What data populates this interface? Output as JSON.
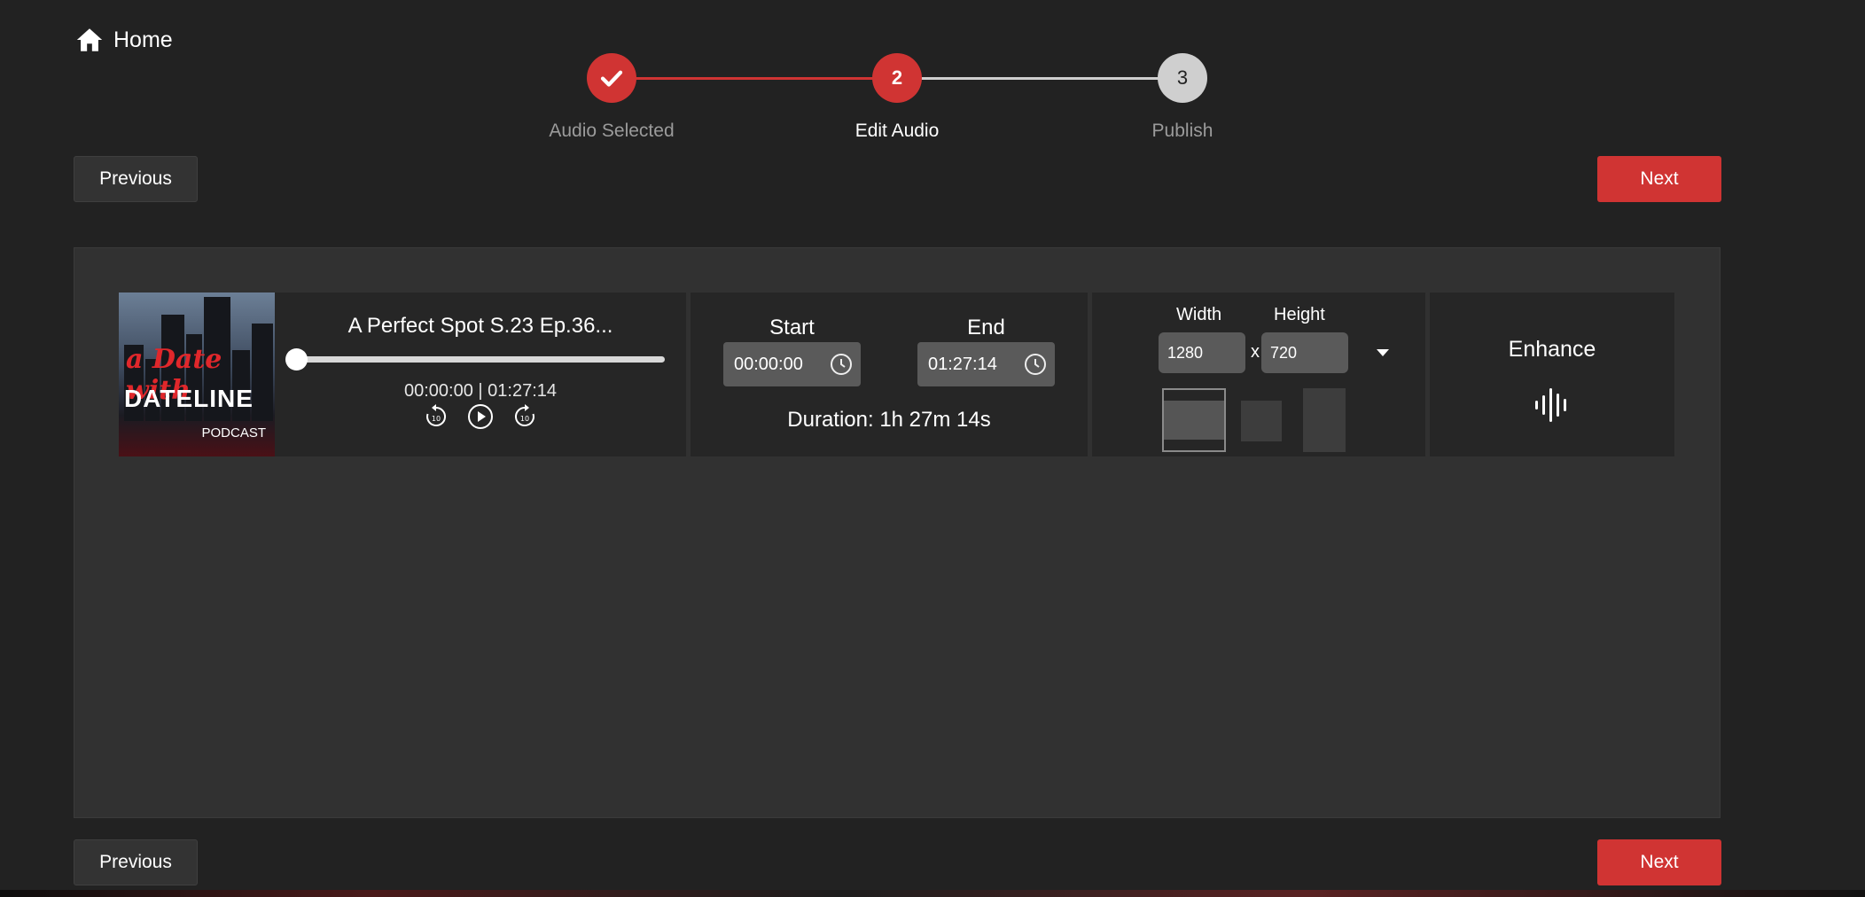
{
  "header": {
    "home_label": "Home"
  },
  "stepper": {
    "steps": [
      {
        "number": "1",
        "label": "Audio Selected",
        "state": "complete"
      },
      {
        "number": "2",
        "label": "Edit Audio",
        "state": "active"
      },
      {
        "number": "3",
        "label": "Publish",
        "state": "pending"
      }
    ]
  },
  "nav": {
    "previous_label": "Previous",
    "next_label": "Next"
  },
  "player": {
    "artwork": {
      "line1": "a Date with",
      "line2": "DATELINE",
      "line3": "PODCAST"
    },
    "track_title": "A Perfect Spot S.23 Ep.36...",
    "position": "00:00:00",
    "separator": "|",
    "total": "01:27:14",
    "progress_fraction": 0,
    "controls": [
      "rewind-10-icon",
      "play-icon",
      "forward-10-icon"
    ]
  },
  "trim": {
    "start_label": "Start",
    "end_label": "End",
    "start_value": "00:00:00",
    "end_value": "01:27:14",
    "duration_text": "Duration: 1h 27m 14s"
  },
  "dimensions": {
    "width_label": "Width",
    "height_label": "Height",
    "width_value": "1280",
    "height_value": "720",
    "separator": "x",
    "selected_aspect": "landscape"
  },
  "enhance": {
    "label": "Enhance",
    "icon": "waveform-icon"
  },
  "colors": {
    "accent": "#d03433",
    "background": "#222222",
    "panel": "#313131",
    "cell": "#262626"
  }
}
